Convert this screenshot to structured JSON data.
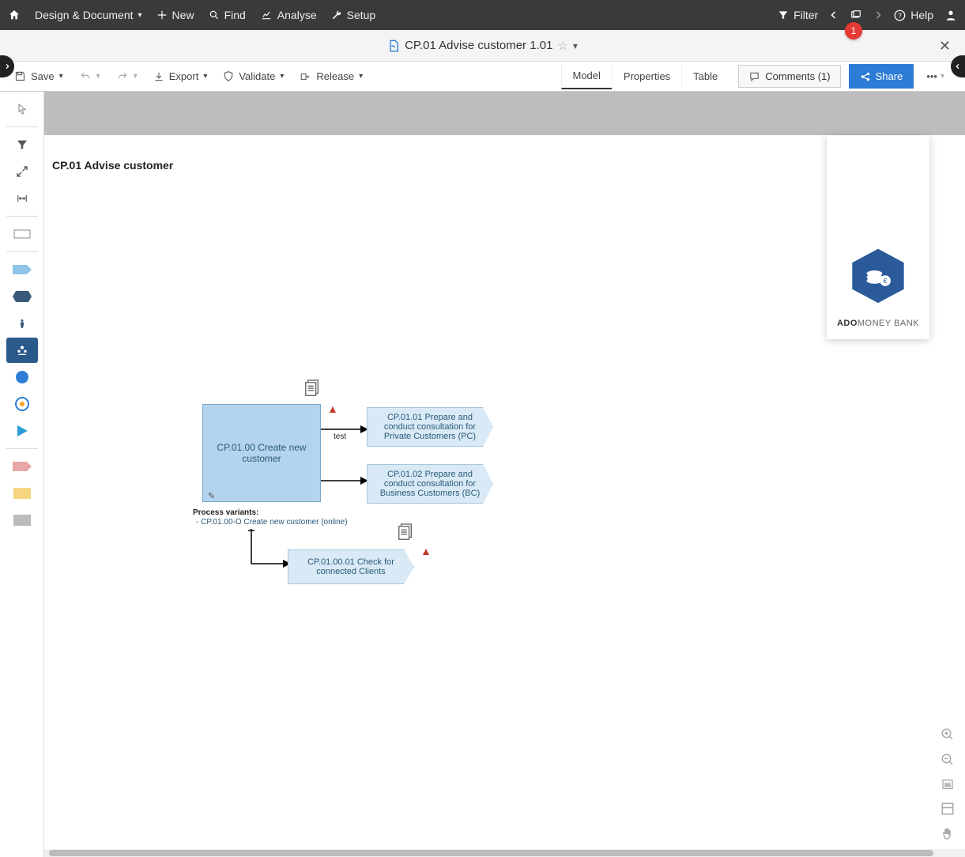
{
  "topbar": {
    "menu_label": "Design & Document",
    "new_label": "New",
    "find_label": "Find",
    "analyse_label": "Analyse",
    "setup_label": "Setup",
    "filter_label": "Filter",
    "help_label": "Help"
  },
  "titlebar": {
    "doc_title": "CP.01 Advise customer 1.01",
    "badge_count": "1"
  },
  "actionbar": {
    "save_label": "Save",
    "export_label": "Export",
    "validate_label": "Validate",
    "release_label": "Release",
    "tabs": {
      "model": "Model",
      "properties": "Properties",
      "table": "Table"
    },
    "comments_label": "Comments (1)",
    "share_label": "Share"
  },
  "canvas": {
    "title": "CP.01 Advise customer",
    "main_process": "CP.01.00 Create new customer",
    "branch_test_label": "test",
    "branch1": "CP.01.01 Prepare and conduct consultation for Private Customers (PC)",
    "branch2": "CP.01.02 Prepare and conduct consultation for Business Customers (BC)",
    "variants_label": "Process variants:",
    "variant_item": "- CP.01.00-O Create new customer (online)",
    "sub_process": "CP.01.00.01 Check for connected Clients"
  },
  "logo": {
    "line1_bold": "ADO",
    "line1_rest": "MONEY BANK"
  }
}
